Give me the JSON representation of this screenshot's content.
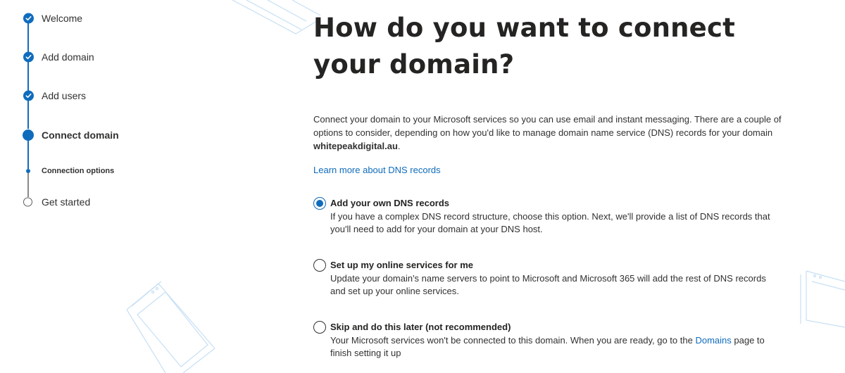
{
  "stepper": {
    "steps": [
      {
        "label": "Welcome",
        "state": "completed",
        "icon": "check-icon"
      },
      {
        "label": "Add domain",
        "state": "completed",
        "icon": "check-icon"
      },
      {
        "label": "Add users",
        "state": "completed",
        "icon": "check-icon"
      },
      {
        "label": "Connect domain",
        "state": "current",
        "icon": "filled-circle-icon"
      },
      {
        "label": "Connection options",
        "state": "current-substep",
        "icon": "dot-icon"
      },
      {
        "label": "Get started",
        "state": "pending",
        "icon": "empty-circle-icon"
      }
    ]
  },
  "main": {
    "title": "How do you want to connect your domain?",
    "intro_text": "Connect your domain to your Microsoft services so you can use email and instant messaging. There are a couple of options to consider, depending on how you'd like to manage domain name service (DNS) records for your domain",
    "domain": "whitepeakdigital.au",
    "intro_suffix": ".",
    "learn_more_link": "Learn more about DNS records",
    "options": [
      {
        "title": "Add your own DNS records",
        "description": "If you have a complex DNS record structure, choose this option. Next, we'll provide a list of DNS records that you'll need to add for your domain at your DNS host.",
        "selected": true
      },
      {
        "title": "Set up my online services for me",
        "description": "Update your domain's name servers to point to Microsoft and Microsoft 365 will add the rest of DNS records and set up your online services.",
        "selected": false
      },
      {
        "title": "Skip and do this later (not recommended)",
        "description_before_link": "Your Microsoft services won't be connected to this domain. When you are ready, go to the",
        "link_text": "Domains",
        "description_after_link": "page to finish setting it up",
        "selected": false
      }
    ]
  },
  "colors": {
    "accent": "#0f6cbd",
    "text": "#323130",
    "heading": "#252423",
    "decoration": "#c7e0f4"
  }
}
